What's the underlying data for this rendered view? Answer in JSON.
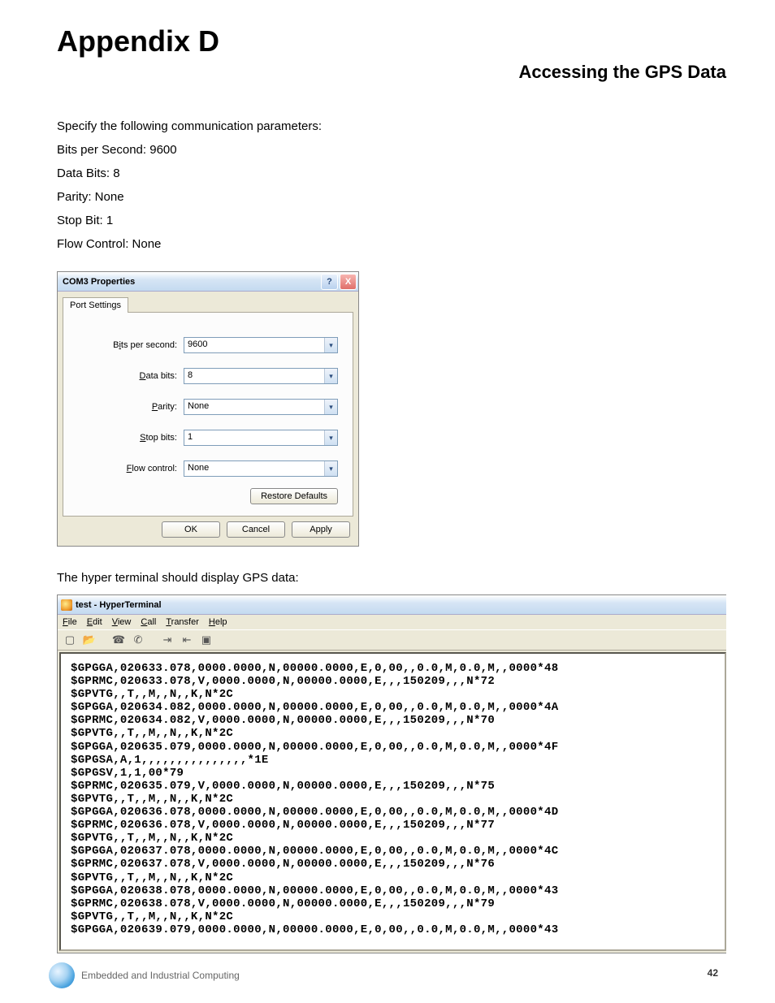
{
  "heading": "Appendix D",
  "subtitle": "Accessing the GPS Data",
  "intro": {
    "p0": "Specify the following communication parameters:",
    "p1": "Bits per Second: 9600",
    "p2": "Data Bits: 8",
    "p3": "Parity: None",
    "p4": "Stop Bit: 1",
    "p5": "Flow Control: None"
  },
  "com_dialog": {
    "title": "COM3 Properties",
    "tab": "Port Settings",
    "fields": {
      "bps_label_pre": "B",
      "bps_label_u": "i",
      "bps_label_post": "ts per second:",
      "bps_value": "9600",
      "db_label_pre": "",
      "db_label_u": "D",
      "db_label_post": "ata bits:",
      "db_value": "8",
      "par_label_pre": "",
      "par_label_u": "P",
      "par_label_post": "arity:",
      "par_value": "None",
      "sb_label_pre": "",
      "sb_label_u": "S",
      "sb_label_post": "top bits:",
      "sb_value": "1",
      "fc_label_pre": "",
      "fc_label_u": "F",
      "fc_label_post": "low control:",
      "fc_value": "None"
    },
    "restore_pre": "",
    "restore_u": "R",
    "restore_post": "estore Defaults",
    "ok": "OK",
    "cancel": "Cancel",
    "apply_pre": "",
    "apply_u": "A",
    "apply_post": "pply"
  },
  "caption2": "The hyper terminal should display GPS data:",
  "hyperterminal": {
    "title": "test - HyperTerminal",
    "menus": {
      "file_u": "F",
      "file_post": "ile",
      "edit_u": "E",
      "edit_post": "dit",
      "view_u": "V",
      "view_post": "iew",
      "call_u": "C",
      "call_post": "all",
      "transfer_u": "T",
      "transfer_post": "ransfer",
      "help_u": "H",
      "help_post": "elp"
    },
    "lines": [
      "$GPGGA,020633.078,0000.0000,N,00000.0000,E,0,00,,0.0,M,0.0,M,,0000*48",
      "$GPRMC,020633.078,V,0000.0000,N,00000.0000,E,,,150209,,,N*72",
      "$GPVTG,,T,,M,,N,,K,N*2C",
      "$GPGGA,020634.082,0000.0000,N,00000.0000,E,0,00,,0.0,M,0.0,M,,0000*4A",
      "$GPRMC,020634.082,V,0000.0000,N,00000.0000,E,,,150209,,,N*70",
      "$GPVTG,,T,,M,,N,,K,N*2C",
      "$GPGGA,020635.079,0000.0000,N,00000.0000,E,0,00,,0.0,M,0.0,M,,0000*4F",
      "$GPGSA,A,1,,,,,,,,,,,,,,,*1E",
      "$GPGSV,1,1,00*79",
      "$GPRMC,020635.079,V,0000.0000,N,00000.0000,E,,,150209,,,N*75",
      "$GPVTG,,T,,M,,N,,K,N*2C",
      "$GPGGA,020636.078,0000.0000,N,00000.0000,E,0,00,,0.0,M,0.0,M,,0000*4D",
      "$GPRMC,020636.078,V,0000.0000,N,00000.0000,E,,,150209,,,N*77",
      "$GPVTG,,T,,M,,N,,K,N*2C",
      "$GPGGA,020637.078,0000.0000,N,00000.0000,E,0,00,,0.0,M,0.0,M,,0000*4C",
      "$GPRMC,020637.078,V,0000.0000,N,00000.0000,E,,,150209,,,N*76",
      "$GPVTG,,T,,M,,N,,K,N*2C",
      "$GPGGA,020638.078,0000.0000,N,00000.0000,E,0,00,,0.0,M,0.0,M,,0000*43",
      "$GPRMC,020638.078,V,0000.0000,N,00000.0000,E,,,150209,,,N*79",
      "$GPVTG,,T,,M,,N,,K,N*2C",
      "$GPGGA,020639.079,0000.0000,N,00000.0000,E,0,00,,0.0,M,0.0,M,,0000*43"
    ]
  },
  "footer_text": "Embedded and Industrial Computing",
  "page_number": "42"
}
